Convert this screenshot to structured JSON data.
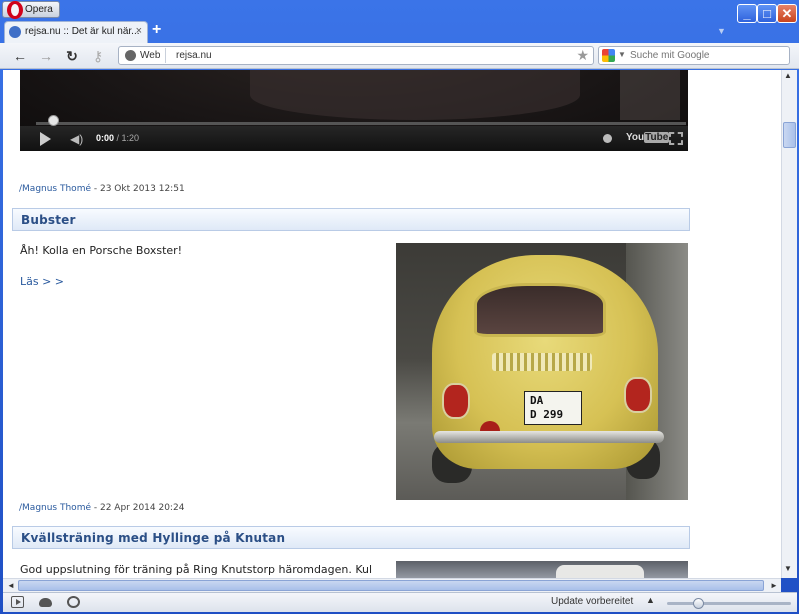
{
  "browser": {
    "menu_label": "Opera",
    "tab": {
      "title": "rejsa.nu :: Det är kul när...",
      "close": "×"
    },
    "new_tab": "+",
    "address": {
      "badge": "Web",
      "url": "rejsa.nu"
    },
    "search": {
      "placeholder": "Suche mit Google"
    },
    "window_buttons": {
      "minimize": "_",
      "maximize": "□",
      "close": "✕"
    },
    "nav": {
      "back": "←",
      "forward": "→",
      "reload": "↻",
      "key": "⚷",
      "star": "★"
    },
    "status": {
      "update_text": "Update vorbereitet",
      "zoom_level": 0.25
    },
    "scrollbars": {
      "up": "▲",
      "down": "▼",
      "left": "◄",
      "right": "►"
    }
  },
  "video": {
    "time_current": "0:00",
    "time_total": " / 1:20",
    "logo_you": "You",
    "logo_tube": "Tube",
    "volume_glyph": "◀)"
  },
  "posts": [
    {
      "meta_author": "/Magnus Thomé",
      "meta_date": " - 23 Okt 2013 12:51"
    },
    {
      "title": "Bubster",
      "text": "Åh! Kolla en Porsche Boxster!",
      "read_more": "Läs > >",
      "plate_line1": "DA",
      "plate_line2": "D 299",
      "meta_author": "/Magnus Thomé",
      "meta_date": " - 22 Apr 2014 20:24"
    },
    {
      "title": "Kvällsträning med Hyllinge på Knutan",
      "text": "God uppslutning för träning på Ring Knutstorp häromdagen. Kul"
    }
  ],
  "colors": {
    "window_frame": "#2a5bd0",
    "link": "#2a5a9e",
    "header_text": "#2b4f86"
  }
}
